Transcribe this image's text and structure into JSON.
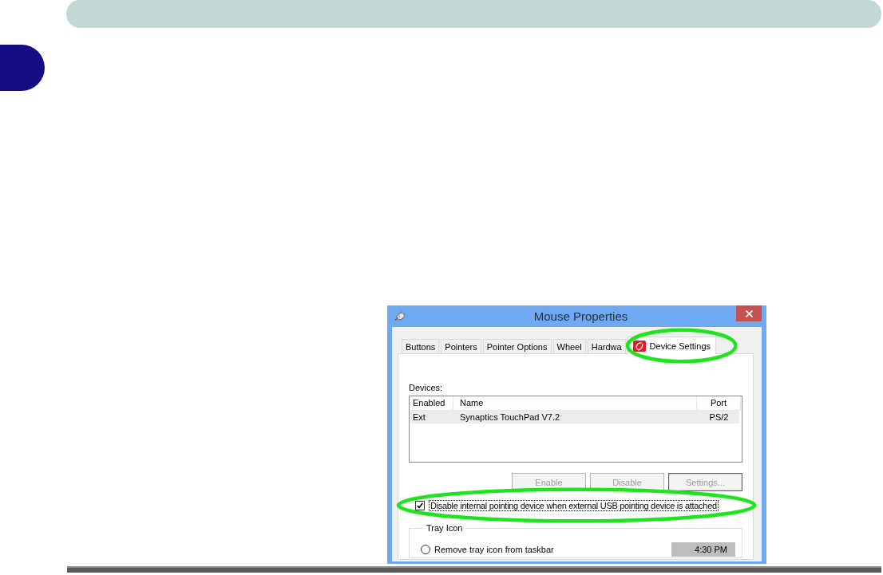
{
  "window": {
    "title": "Mouse Properties"
  },
  "tabs": [
    {
      "label": "Buttons",
      "selected": false,
      "kind": "plain",
      "highlighted": false
    },
    {
      "label": "Pointers",
      "selected": false,
      "kind": "plain",
      "highlighted": false
    },
    {
      "label": "Pointer Options",
      "selected": false,
      "kind": "plain",
      "highlighted": false
    },
    {
      "label": "Wheel",
      "selected": false,
      "kind": "plain",
      "highlighted": false
    },
    {
      "label": "Hardwa",
      "selected": false,
      "kind": "plain",
      "highlighted": false
    },
    {
      "label": "Device Settings",
      "selected": true,
      "kind": "icon",
      "highlighted": true
    }
  ],
  "devices": {
    "label": "Devices:",
    "columns": [
      "Enabled",
      "Name",
      "Port"
    ],
    "rows": [
      {
        "cells": [
          "Ext",
          "Synaptics TouchPad V7.2",
          "PS/2"
        ],
        "selected": true
      }
    ]
  },
  "device_buttons": [
    {
      "label": "Enable",
      "disabled": true,
      "default": false
    },
    {
      "label": "Disable",
      "disabled": true,
      "default": false
    },
    {
      "label": "Settings...",
      "disabled": true,
      "default": true
    }
  ],
  "disable_internal": {
    "label": "Disable internal pointing device when external USB pointing device is attached",
    "checked": true,
    "focused": true,
    "highlighted": true
  },
  "tray_icon": {
    "title": "Tray Icon",
    "options": [
      {
        "label": "Remove tray icon from taskbar",
        "selected": false
      }
    ],
    "preview": "4:30 PM"
  }
}
